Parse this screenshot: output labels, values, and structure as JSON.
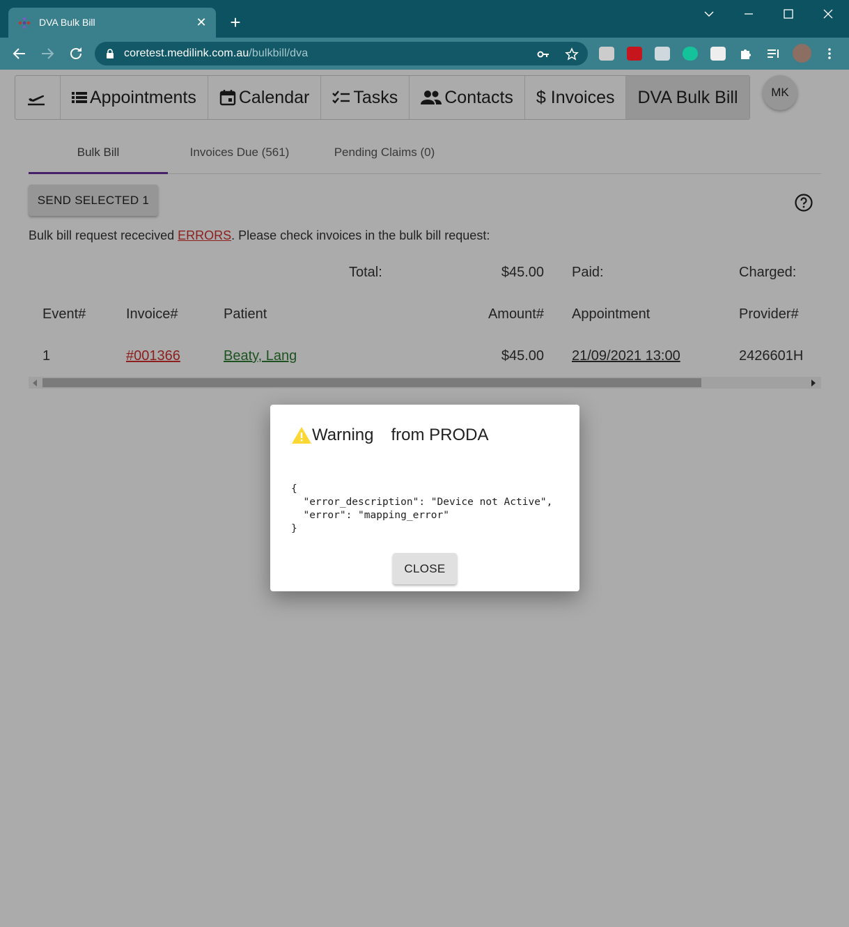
{
  "browser": {
    "tab_title": "DVA Bulk Bill",
    "tab_close": "✕",
    "new_tab": "+",
    "url_host": "coretest.medilink.com.au",
    "url_path": "/bulkbill/dva",
    "extensions": [
      "css-viewer-icon",
      "acrobat-icon",
      "extension-icon",
      "grammarly-icon",
      "incognito-icon",
      "puzzle-extensions-icon",
      "reading-list-icon",
      "profile-avatar"
    ]
  },
  "nav": {
    "items": [
      {
        "label": "",
        "icon": "flight-takeoff-icon"
      },
      {
        "label": "Appointments",
        "icon": "list-icon"
      },
      {
        "label": "Calendar",
        "icon": "calendar-icon"
      },
      {
        "label": "Tasks",
        "icon": "checklist-icon"
      },
      {
        "label": "Contacts",
        "icon": "people-icon"
      },
      {
        "label": "$ Invoices",
        "icon": ""
      },
      {
        "label": "DVA Bulk Bill",
        "icon": ""
      }
    ],
    "avatar": "MK"
  },
  "tabs": [
    {
      "label": "Bulk Bill",
      "active": true
    },
    {
      "label": "Invoices Due (561)",
      "active": false
    },
    {
      "label": "Pending Claims (0)",
      "active": false
    }
  ],
  "send_button": "SEND SELECTED 1",
  "message": {
    "prefix": "Bulk bill request rececived ",
    "link": "ERRORS",
    "suffix": ". Please check invoices in the bulk bill request:"
  },
  "totals": {
    "total_label": "Total:",
    "total_value": "$45.00",
    "paid_label": "Paid:",
    "charged_label": "Charged:"
  },
  "table": {
    "headers": [
      "Event#",
      "Invoice#",
      "Patient",
      "Amount#",
      "Appointment",
      "Provider#"
    ],
    "rows": [
      {
        "event": "1",
        "invoice": "#001366",
        "patient": "Beaty, Lang",
        "amount": "$45.00",
        "appointment": "21/09/2021 13:00",
        "provider": "2426601H"
      }
    ]
  },
  "dialog": {
    "title_a": "Warning",
    "title_b": "from PRODA",
    "body": "{\n  \"error_description\": \"Device not Active\",\n  \"error\": \"mapping_error\"\n}",
    "close": "CLOSE"
  },
  "colors": {
    "titlebar": "#0d5261",
    "toolbar": "#3a7f8c",
    "error_link": "#d32f2f",
    "patient_link": "#2e7d32",
    "active_tab_underline": "#6a2fa0",
    "warning": "#fdd835"
  }
}
